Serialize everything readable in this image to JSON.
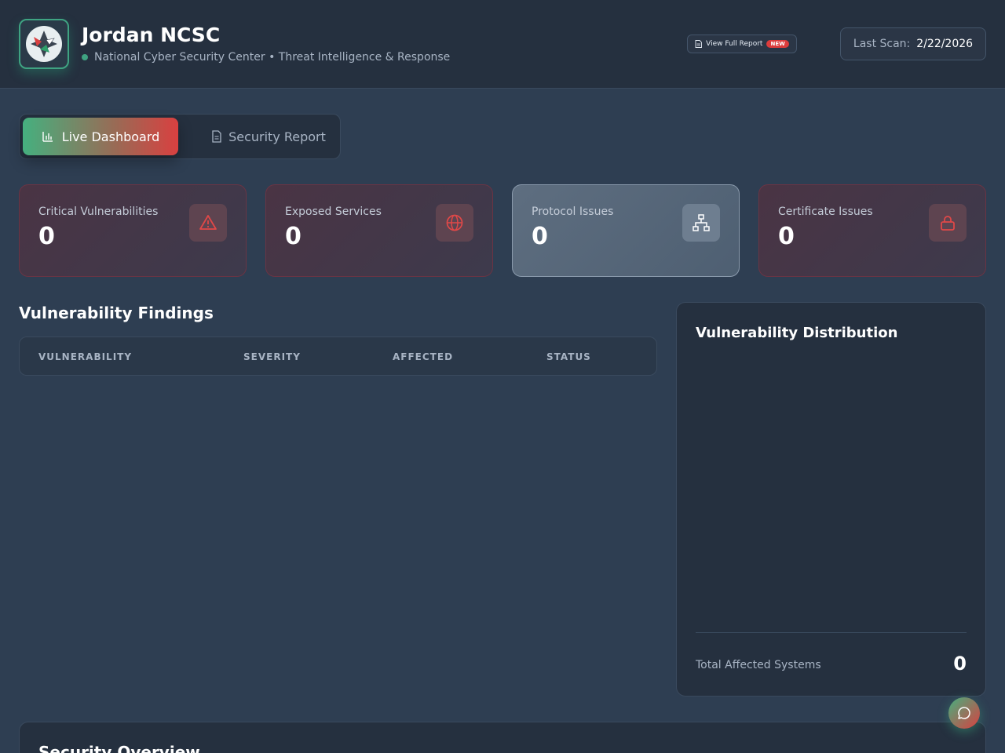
{
  "header": {
    "title": "Jordan NCSC",
    "subtitle": "National Cyber Security Center • Threat Intelligence & Response",
    "report_button": "View Full Report",
    "report_badge": "NEW",
    "last_scan_label": "Last Scan:",
    "last_scan_value": "2/22/2026"
  },
  "tabs": {
    "live": "Live Dashboard",
    "report": "Security Report"
  },
  "stats": [
    {
      "label": "Critical Vulnerabilities",
      "value": "0",
      "icon": "warning-icon"
    },
    {
      "label": "Exposed Services",
      "value": "0",
      "icon": "globe-icon"
    },
    {
      "label": "Protocol Issues",
      "value": "0",
      "icon": "network-icon"
    },
    {
      "label": "Certificate Issues",
      "value": "0",
      "icon": "lock-icon"
    }
  ],
  "findings": {
    "title": "Vulnerability Findings",
    "columns": [
      "VULNERABILITY",
      "SEVERITY",
      "AFFECTED",
      "STATUS"
    ]
  },
  "distribution": {
    "title": "Vulnerability Distribution",
    "total_label": "Total Affected Systems",
    "total_value": "0"
  },
  "overview": {
    "title": "Security Overview"
  },
  "colors": {
    "accent_green": "#45b07f",
    "accent_red": "#d94040",
    "background": "#2e3e52",
    "panel": "#25303f"
  }
}
